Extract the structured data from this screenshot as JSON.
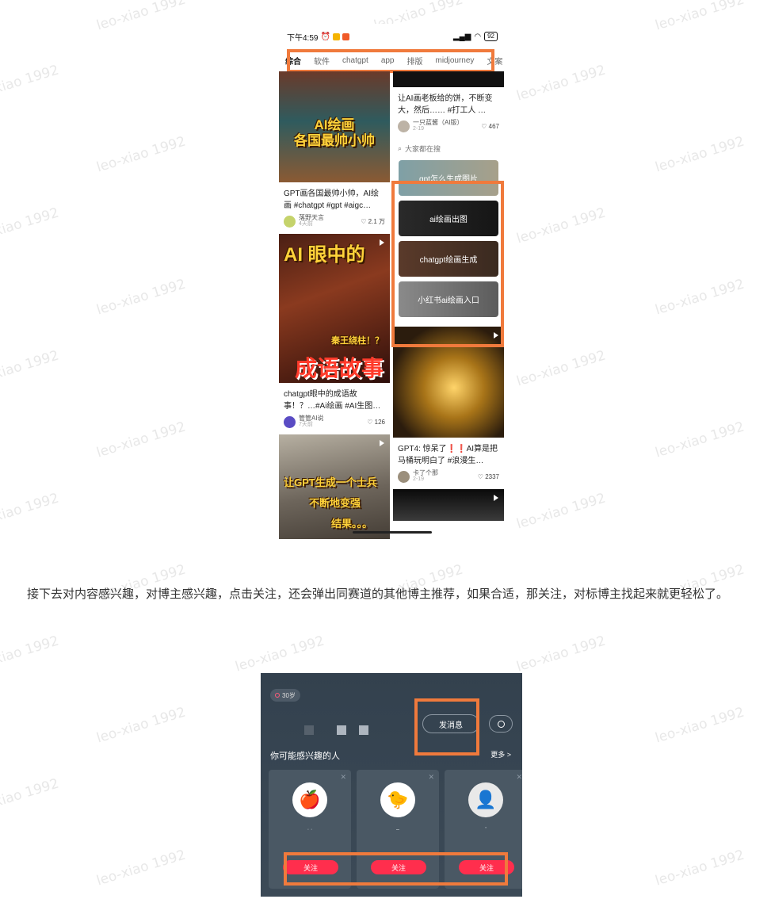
{
  "watermark": "leo-xiao 1992",
  "phone1": {
    "status": {
      "time": "下午4:59",
      "battery": "92"
    },
    "tabs": [
      "综合",
      "软件",
      "chatgpt",
      "app",
      "排版",
      "midjourney",
      "文案"
    ],
    "left_cards": [
      {
        "overlay": [
          "AI绘画",
          "各国最帅小帅"
        ],
        "text": "GPT画各国最帅小帅，AI绘画 #chatgpt  #gpt  #aigc…",
        "author": "落野天言",
        "time": "4天前",
        "likes": "2.1 万"
      },
      {
        "overlay": [
          "AI 眼中的",
          "秦王绕柱！？",
          "成语故事"
        ],
        "text": "chatgpt眼中的成语故事！？…#Ai绘画 #AI生图…",
        "author": "管管AI说",
        "time": "7天前",
        "likes": "126"
      },
      {
        "overlay": [
          "让GPT生成一个士兵",
          "不断地变强",
          "结果。。。"
        ]
      }
    ],
    "right_cards": [
      {
        "text": "让AI画老板给的饼，不断变大，然后…… #打工人 …",
        "author": "一只蓝酱（AI版）",
        "time": "2-19",
        "likes": "467"
      },
      {
        "text": "GPT4: 惊呆了❗❗AI算是把马桶玩明白了 #浪漫生…",
        "author": "卡了个那",
        "time": "2-19",
        "likes": "2337"
      }
    ],
    "search_hint": "大家都在搜",
    "suggestions": [
      "gpt怎么生成图片",
      "ai绘画出图",
      "chatgpt绘画生成",
      "小红书ai绘画入口"
    ]
  },
  "paragraph": "接下去对内容感兴趣，对博主感兴趣，点击关注，还会弹出同赛道的其他博主推荐，如果合适，那关注，对标博主找起来就更轻松了。",
  "phone2": {
    "age": "30岁",
    "message_button": "发消息",
    "rec_title": "你可能感兴趣的人",
    "more": "更多 >",
    "cards": [
      {
        "avatar_icon": "apple",
        "follow": "关注"
      },
      {
        "avatar_icon": "chick",
        "follow": "关注"
      },
      {
        "avatar_icon": "person",
        "follow": "关注"
      }
    ]
  },
  "colors": {
    "highlight": "#f07a3c",
    "follow": "#ff2e4d"
  }
}
